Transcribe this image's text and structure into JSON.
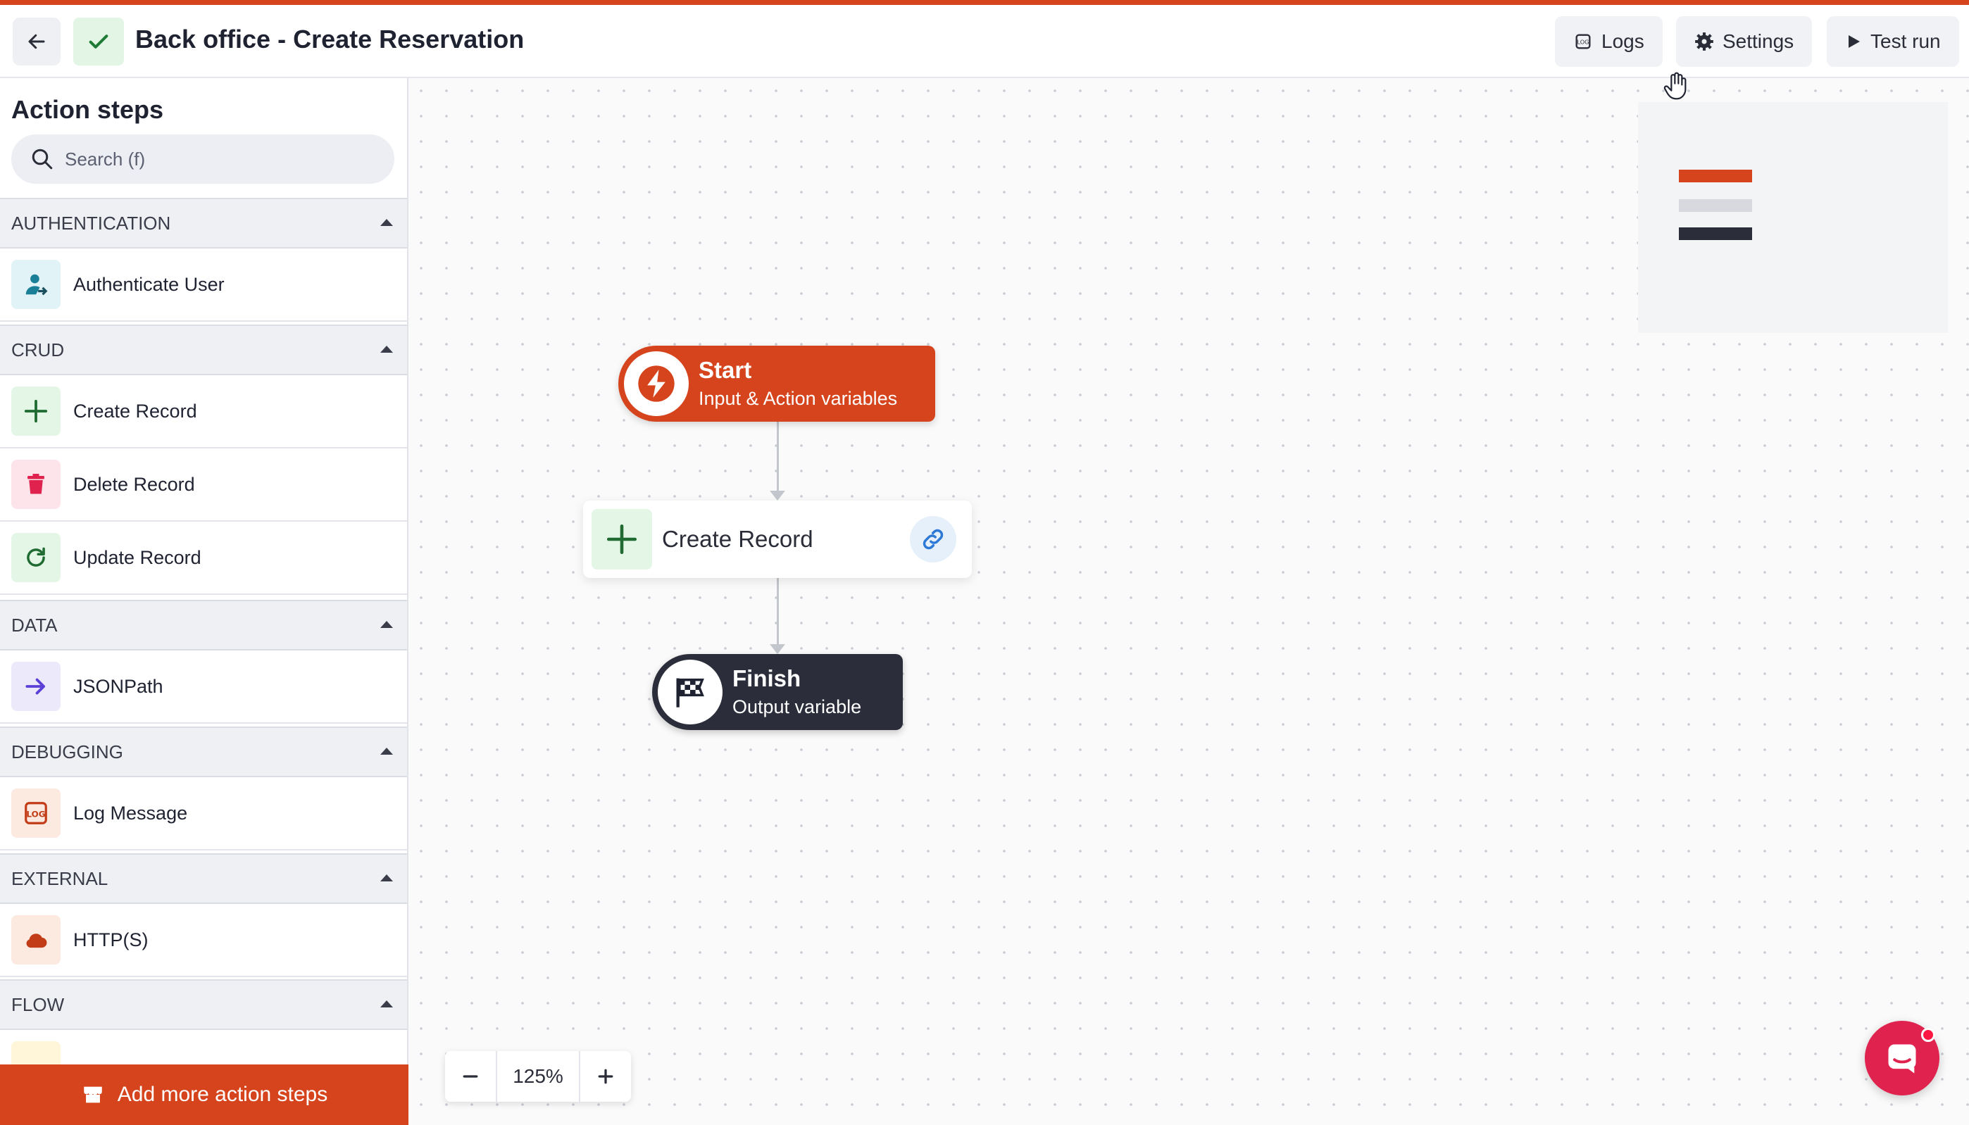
{
  "header": {
    "title": "Back office - Create Reservation",
    "buttons": {
      "logs": "Logs",
      "settings": "Settings",
      "test_run": "Test run"
    }
  },
  "sidebar": {
    "title": "Action steps",
    "search_placeholder": "Search (f)",
    "categories": [
      {
        "name": "AUTHENTICATION",
        "items": [
          {
            "label": "Authenticate User",
            "icon": "user-auth-icon"
          }
        ]
      },
      {
        "name": "CRUD",
        "items": [
          {
            "label": "Create Record",
            "icon": "plus-icon"
          },
          {
            "label": "Delete Record",
            "icon": "trash-icon"
          },
          {
            "label": "Update Record",
            "icon": "refresh-icon"
          }
        ]
      },
      {
        "name": "DATA",
        "items": [
          {
            "label": "JSONPath",
            "icon": "arrow-right-icon"
          }
        ]
      },
      {
        "name": "DEBUGGING",
        "items": [
          {
            "label": "Log Message",
            "icon": "log-icon"
          }
        ]
      },
      {
        "name": "EXTERNAL",
        "items": [
          {
            "label": "HTTP(S)",
            "icon": "cloud-icon"
          }
        ]
      },
      {
        "name": "FLOW",
        "items": []
      }
    ],
    "add_more_label": "Add more action steps"
  },
  "canvas": {
    "start_node": {
      "title": "Start",
      "subtitle": "Input & Action variables"
    },
    "record_node": {
      "label": "Create Record"
    },
    "finish_node": {
      "title": "Finish",
      "subtitle": "Output variable"
    },
    "zoom_level": "125%"
  },
  "colors": {
    "accent": "#d5441c",
    "dark": "#2b2d3a",
    "success_bg": "#e3f6e5",
    "chat": "#e0224e"
  }
}
